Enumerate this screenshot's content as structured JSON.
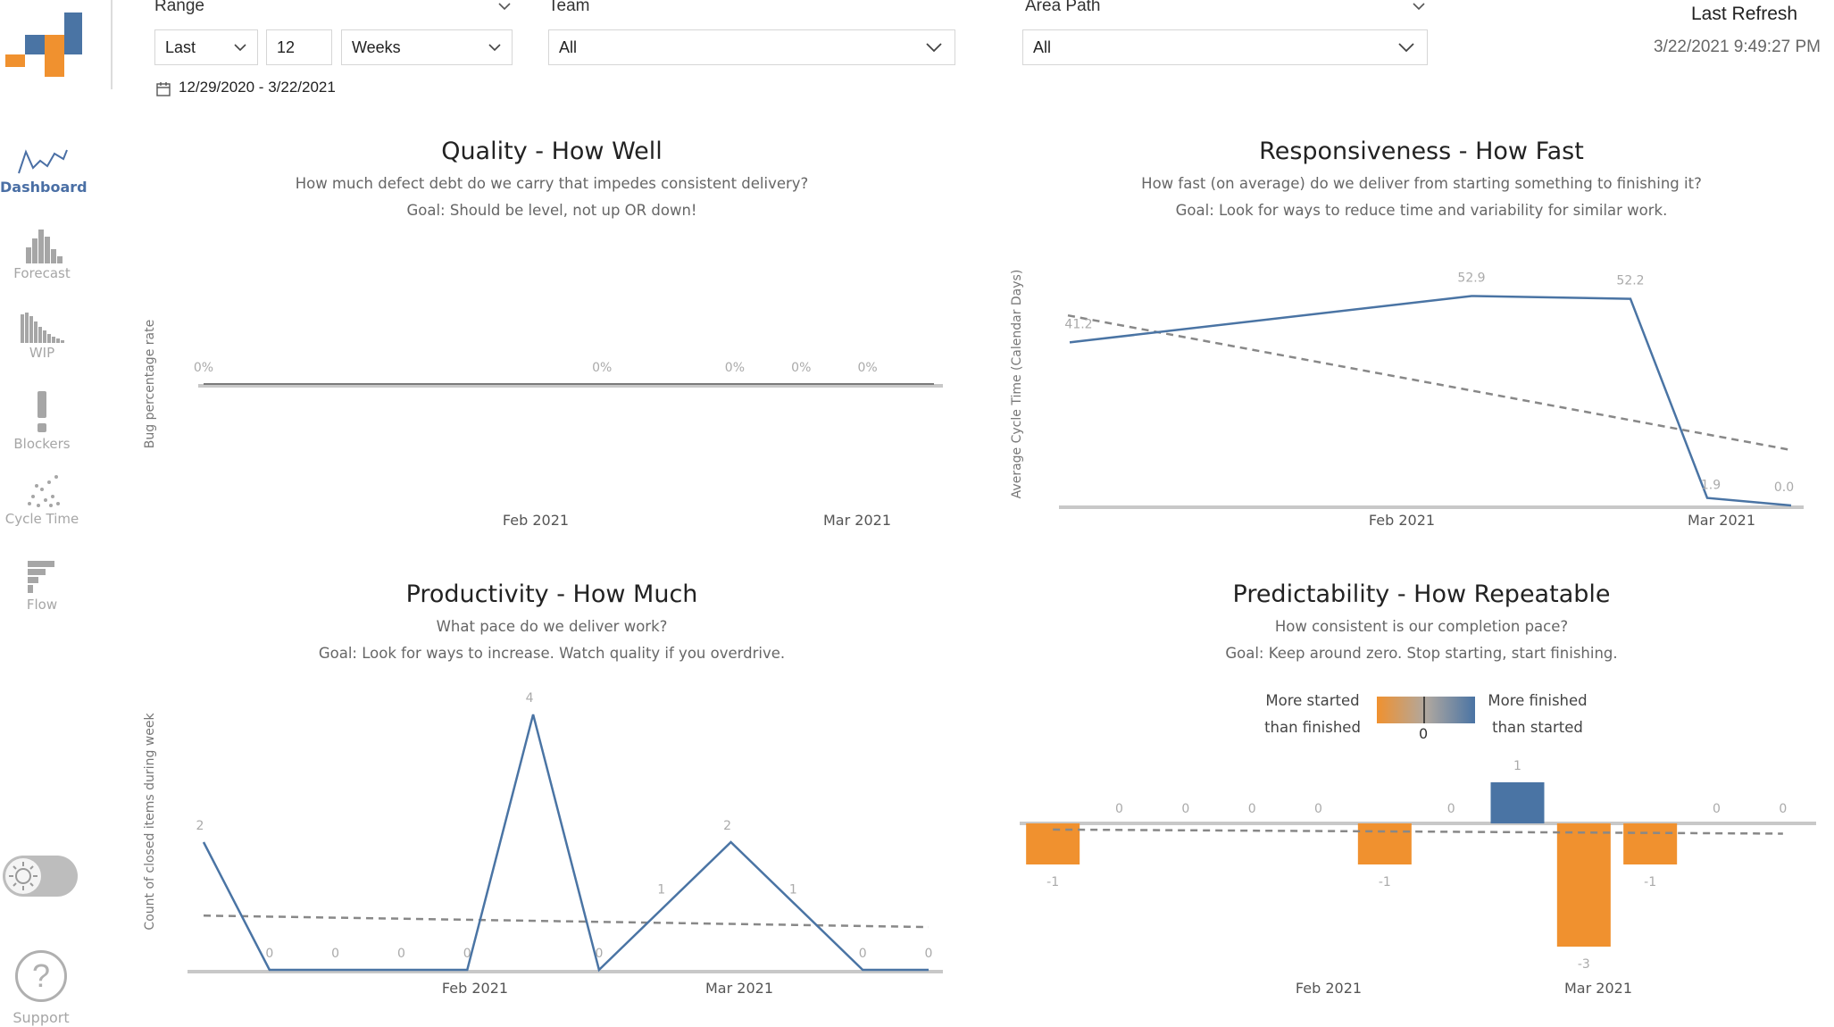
{
  "colors": {
    "accent": "#4a6fa5",
    "orange": "#f0912f",
    "blue": "#4a74a4",
    "trend": "#888888",
    "axis": "#c8c8c8",
    "muted": "#a6a6a6"
  },
  "sidebar": {
    "items": [
      {
        "label": "Dashboard",
        "icon": "dashboard-icon",
        "active": true
      },
      {
        "label": "Forecast",
        "icon": "forecast-icon",
        "active": false
      },
      {
        "label": "WIP",
        "icon": "wip-icon",
        "active": false
      },
      {
        "label": "Blockers",
        "icon": "blockers-icon",
        "active": false
      },
      {
        "label": "Cycle Time",
        "icon": "cycle-time-icon",
        "active": false
      },
      {
        "label": "Flow",
        "icon": "flow-icon",
        "active": false
      }
    ],
    "support_label": "Support",
    "support_glyph": "?"
  },
  "filters": {
    "range_label": "Range",
    "range_mode": "Last",
    "range_count": "12",
    "range_unit": "Weeks",
    "date_range": "12/29/2020 - 3/22/2021",
    "team_label": "Team",
    "team_value": "All",
    "area_label": "Area Path",
    "area_value": "All"
  },
  "refresh": {
    "title": "Last Refresh",
    "value": "3/22/2021 9:49:27 PM"
  },
  "quality": {
    "title": "Quality - How Well",
    "subtitle": "How much defect debt do we carry that impedes consistent delivery?",
    "goal": "Goal: Should be level, not up OR down!"
  },
  "responsiveness": {
    "title": "Responsiveness - How Fast",
    "subtitle": "How fast (on average) do we deliver from starting something to finishing it?",
    "goal": "Goal: Look for ways to reduce time and variability for similar work."
  },
  "productivity": {
    "title": "Productivity - How Much",
    "subtitle": "What pace do we deliver work?",
    "goal": "Goal: Look for ways to increase. Watch quality if you overdrive."
  },
  "predictability": {
    "title": "Predictability - How Repeatable",
    "subtitle": "How consistent is our completion pace?",
    "goal": "Goal: Keep around zero. Stop starting, start finishing.",
    "legend_left_1": "More started",
    "legend_left_2": "than finished",
    "legend_right_1": "More finished",
    "legend_right_2": "than started",
    "legend_zero": "0"
  },
  "chart_data": [
    {
      "id": "quality",
      "type": "line",
      "ylabel": "Bug percentage rate",
      "x_ticks": [
        "Feb 2021",
        "Mar 2021"
      ],
      "series": [
        {
          "values": [
            0,
            0,
            0,
            0,
            0,
            0,
            0,
            0,
            0,
            0,
            0,
            0
          ],
          "labels": [
            "0%",
            "",
            "",
            "",
            "",
            "",
            "0%",
            "",
            "0%",
            "0%",
            "0%",
            ""
          ]
        }
      ],
      "trend": [
        0,
        0
      ]
    },
    {
      "id": "responsiveness",
      "type": "line",
      "ylabel": "Average Cycle Time (Calendar Days)",
      "x_ticks": [
        "Feb 2021",
        "Mar 2021"
      ],
      "series": [
        {
          "values": [
            41.2,
            52.9,
            52.2,
            1.9,
            0.0
          ],
          "labels": [
            "41.2",
            "52.9",
            "52.2",
            "1.9",
            "0.0"
          ]
        }
      ],
      "trend": [
        48,
        14
      ]
    },
    {
      "id": "productivity",
      "type": "line",
      "ylabel": "Count of closed items during week",
      "x_ticks": [
        "Feb 2021",
        "Mar 2021"
      ],
      "series": [
        {
          "values": [
            2,
            0,
            0,
            0,
            0,
            4,
            0,
            1,
            2,
            1,
            0,
            0
          ],
          "labels": [
            "2",
            "0",
            "0",
            "0",
            "0",
            "4",
            "0",
            "1",
            "2",
            "1",
            "0",
            "0"
          ]
        }
      ],
      "trend": [
        0.85,
        0.67
      ]
    },
    {
      "id": "predictability",
      "type": "bar",
      "x_ticks": [
        "Feb 2021",
        "Mar 2021"
      ],
      "series": [
        {
          "values": [
            -1,
            0,
            0,
            0,
            0,
            -1,
            0,
            1,
            -3,
            -1,
            0,
            0
          ],
          "labels": [
            "-1",
            "0",
            "0",
            "0",
            "0",
            "-1",
            "0",
            "1",
            "-3",
            "-1",
            "0",
            "0"
          ]
        }
      ],
      "trend": [
        -0.15,
        -0.25
      ]
    }
  ]
}
